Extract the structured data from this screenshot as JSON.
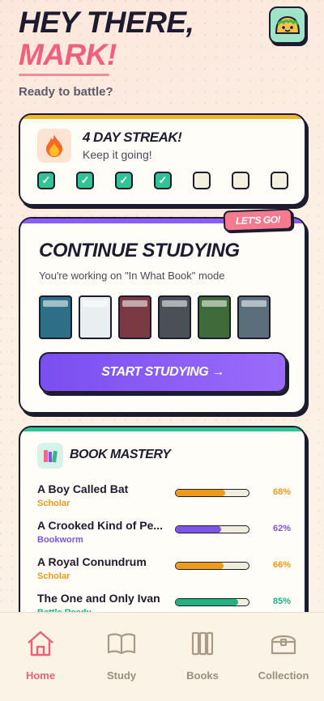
{
  "header": {
    "line1": "HEY THERE,",
    "line2": "MARK!",
    "subtitle": "Ready to battle?"
  },
  "avatar": {
    "icon": "taco-icon"
  },
  "streak": {
    "title": "4 DAY STREAK!",
    "subtitle": "Keep it going!",
    "icon": "fire-icon",
    "days_total": 7,
    "days_done": 4,
    "check": "✓",
    "accent": "#f4b521"
  },
  "study": {
    "badge": "LET'S GO!",
    "title": "CONTINUE STUDYING",
    "subtitle": "You're working on \"In What Book\" mode",
    "button": "START STUDYING →",
    "book_colors": [
      "#2f6f86",
      "#e9eef1",
      "#7a3a44",
      "#4a4f58",
      "#3f6b3a",
      "#5a6e7c"
    ],
    "accent": "#8b5cf6"
  },
  "mastery": {
    "title": "BOOK MASTERY",
    "icon": "books-icon",
    "rows": [
      {
        "name": "A Boy Called Bat",
        "rank": "Scholar",
        "pct_label": "68%",
        "progress": 0.68,
        "color": "#f09a1a"
      },
      {
        "name": "A Crooked Kind of Pe...",
        "rank": "Bookworm",
        "pct_label": "62%",
        "progress": 0.62,
        "color": "#7b56e6"
      },
      {
        "name": "A Royal Conundrum",
        "rank": "Scholar",
        "pct_label": "66%",
        "progress": 0.66,
        "color": "#f09a1a"
      },
      {
        "name": "The One and Only Ivan",
        "rank": "Battle Ready",
        "pct_label": "85%",
        "progress": 0.85,
        "color": "#20b27e"
      }
    ]
  },
  "nav": {
    "items": [
      {
        "label": "Home",
        "icon": "home-icon",
        "active": true
      },
      {
        "label": "Study",
        "icon": "open-book-icon",
        "active": false
      },
      {
        "label": "Books",
        "icon": "bookshelf-icon",
        "active": false
      },
      {
        "label": "Collection",
        "icon": "treasure-chest-icon",
        "active": false
      }
    ]
  }
}
